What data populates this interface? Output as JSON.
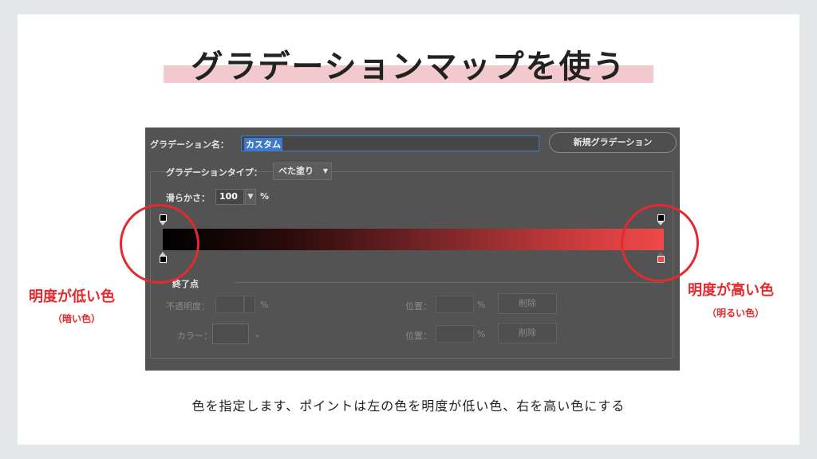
{
  "title": "グラデーションマップを使う",
  "panel": {
    "name_label": "グラデーション名：",
    "name_value": "カスタム",
    "new_gradient_button": "新規グラデーション",
    "type_label": "グラデーションタイプ：",
    "type_value": "べた塗り",
    "smoothness_label": "滑らかさ：",
    "smoothness_value": "100",
    "smoothness_unit": "%",
    "gradient_start_color": "#000000",
    "gradient_end_color": "#f04848",
    "stops_label": "終了点",
    "opacity_label": "不透明度：",
    "opacity_unit": "%",
    "location_label_1": "位置：",
    "location_unit_1": "%",
    "delete_button_1": "削除",
    "color_label": "カラー：",
    "location_label_2": "位置：",
    "location_unit_2": "%",
    "delete_button_2": "削除"
  },
  "annotations": {
    "left_main": "明度が低い色",
    "left_sub": "（暗い色）",
    "right_main": "明度が高い色",
    "right_sub": "（明るい色）",
    "accent_color": "#e22a2f"
  },
  "caption": "色を指定します、ポイントは左の色を明度が低い色、右を高い色にする"
}
